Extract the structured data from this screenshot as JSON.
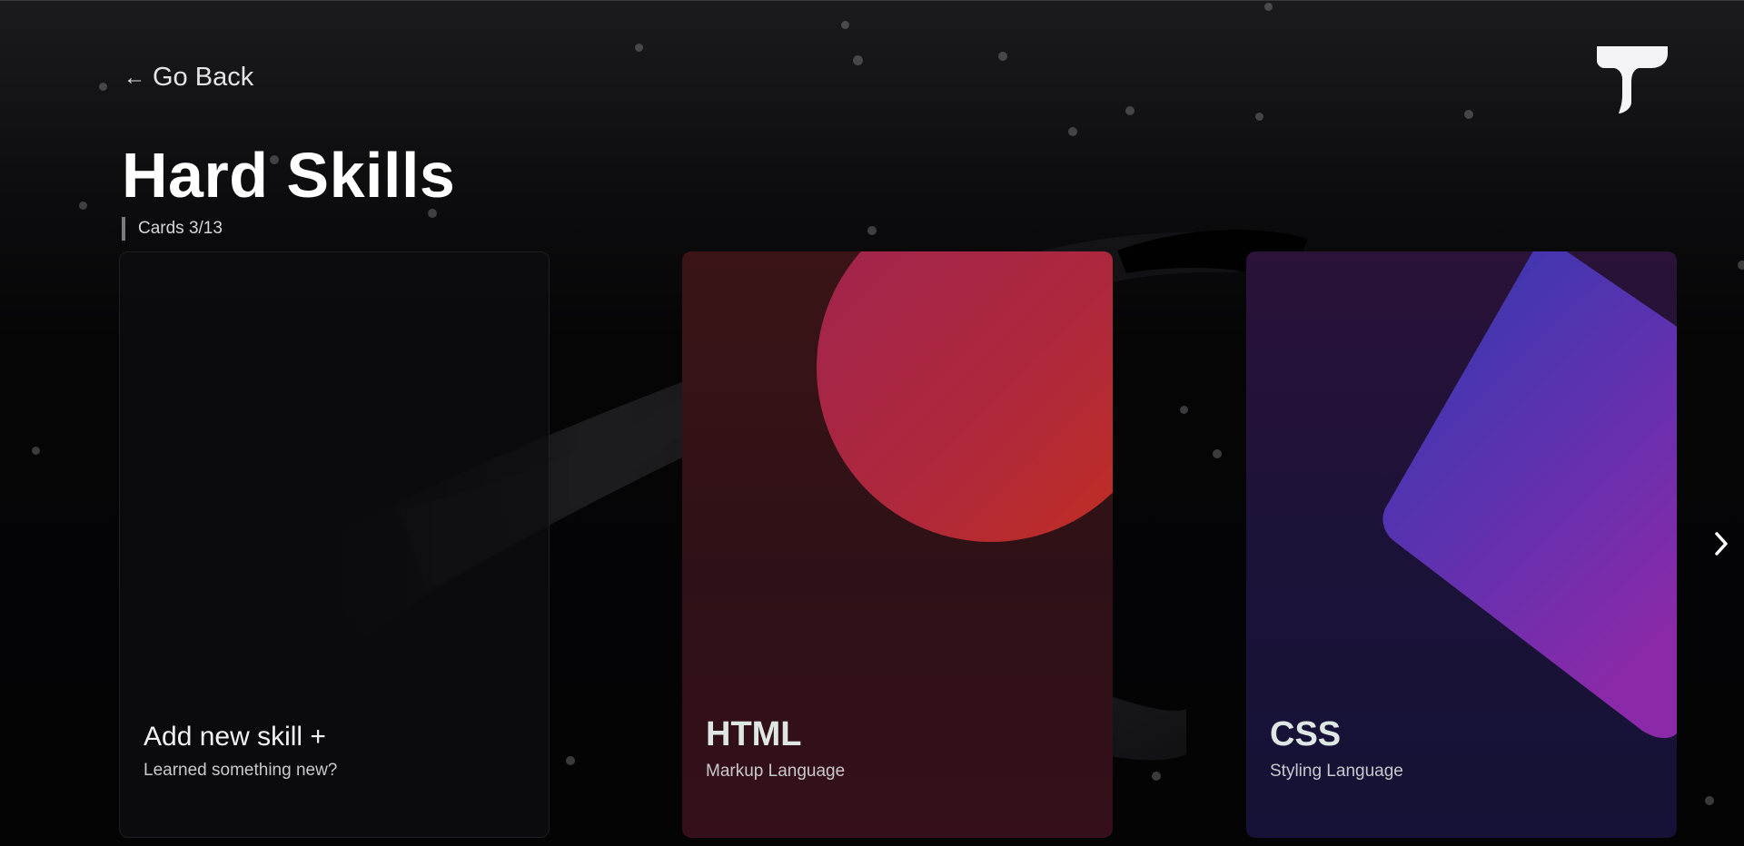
{
  "nav": {
    "back_arrow": "←",
    "back_label": "Go Back",
    "logo_icon": "brand-t-logo-icon"
  },
  "header": {
    "title": "Hard Skills",
    "counter": "Cards 3/13"
  },
  "cards": [
    {
      "title": "Add new skill +",
      "subtitle": "Learned something new?",
      "kind": "add"
    },
    {
      "title": "HTML",
      "subtitle": "Markup Language",
      "accent": "#c0282a",
      "shape": "circle"
    },
    {
      "title": "CSS",
      "subtitle": "Styling Language",
      "accent": "#6a2fb3",
      "shape": "diamond"
    }
  ],
  "controls": {
    "next_icon": "chevron-right-icon"
  },
  "colors": {
    "background": "#050506",
    "html_card": "#2e1116",
    "css_card": "#1c1238",
    "text": "#ffffff"
  }
}
